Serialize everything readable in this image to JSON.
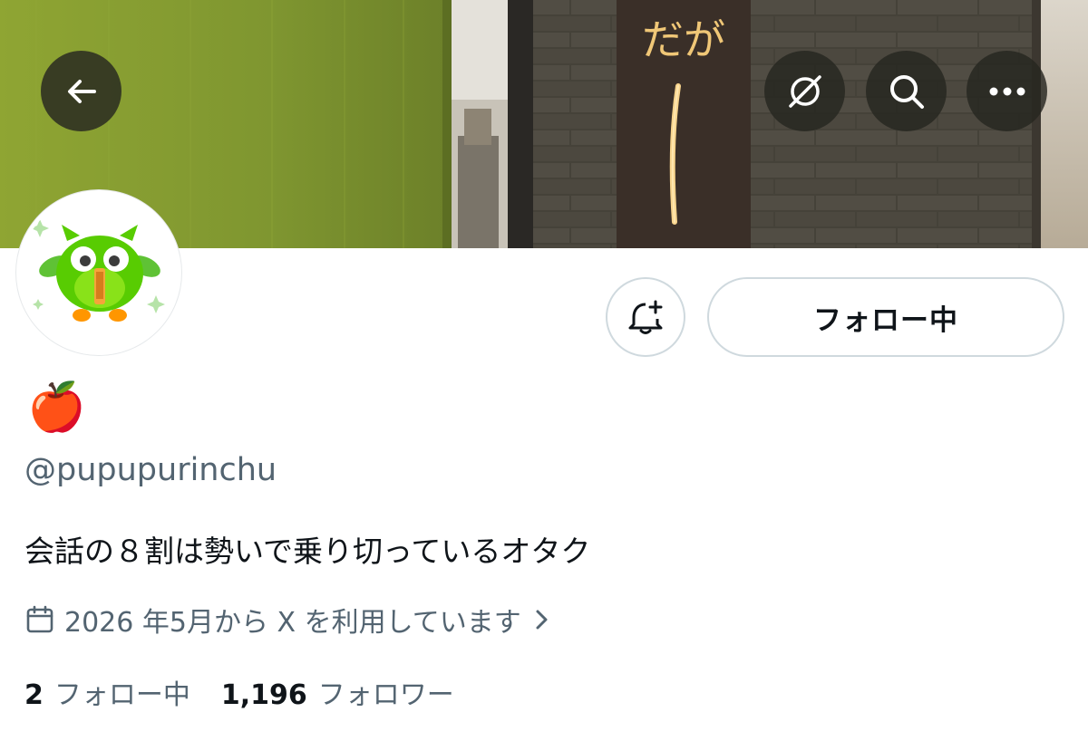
{
  "header": {
    "back_icon": "arrow-left-icon",
    "grok_icon": "grok-icon",
    "search_icon": "search-icon",
    "more_icon": "more-horizontal-icon",
    "banner_sign_text": "だが"
  },
  "actions": {
    "notify_icon": "bell-plus-icon",
    "follow_label": "フォロー中"
  },
  "profile": {
    "display_name": "🍎",
    "handle": "@pupupurinchu",
    "bio": "会話の８割は勢いで乗り切っているオタク",
    "joined_icon": "calendar-icon",
    "joined": "2026 年5月から X を利用しています",
    "joined_chevron": "chevron-right-icon"
  },
  "stats": {
    "following_count": "2",
    "following_label": "フォロー中",
    "followers_count": "1,196",
    "followers_label": "フォロワー"
  },
  "colors": {
    "text_primary": "#0f1419",
    "text_secondary": "#536471",
    "border": "#cfd9de",
    "button_overlay": "#262620"
  }
}
